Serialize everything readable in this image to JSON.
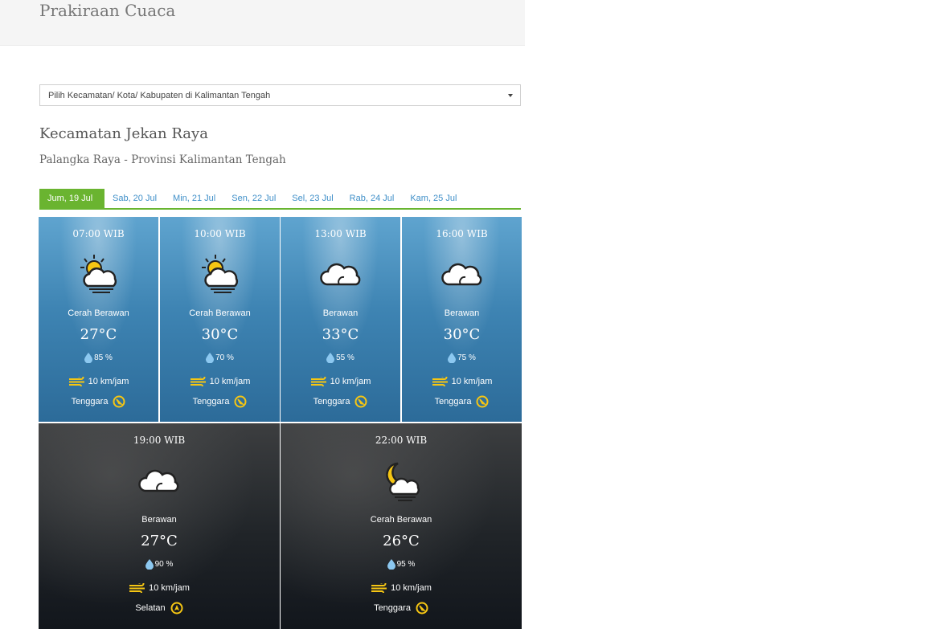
{
  "page": {
    "title": "Prakiraan Cuaca"
  },
  "selector": {
    "value": "Pilih Kecamatan/ Kota/ Kabupaten di Kalimantan Tengah"
  },
  "location": {
    "title": "Kecamatan Jekan Raya",
    "subtitle": "Palangka Raya - Provinsi Kalimantan Tengah"
  },
  "tabs": [
    {
      "label": "Jum, 19 Jul",
      "active": true
    },
    {
      "label": "Sab, 20 Jul",
      "active": false
    },
    {
      "label": "Min, 21 Jul",
      "active": false
    },
    {
      "label": "Sen, 22 Jul",
      "active": false
    },
    {
      "label": "Sel, 23 Jul",
      "active": false
    },
    {
      "label": "Rab, 24 Jul",
      "active": false
    },
    {
      "label": "Kam, 25 Jul",
      "active": false
    }
  ],
  "forecast": [
    {
      "time": "07:00 WIB",
      "icon": "partly-cloudy-sun-icon",
      "condition": "Cerah Berawan",
      "temp": "27°C",
      "humidity": "85 %",
      "wind": "10 km/jam",
      "direction": "Tenggara",
      "period": "day"
    },
    {
      "time": "10:00 WIB",
      "icon": "partly-cloudy-sun-icon",
      "condition": "Cerah Berawan",
      "temp": "30°C",
      "humidity": "70 %",
      "wind": "10 km/jam",
      "direction": "Tenggara",
      "period": "day"
    },
    {
      "time": "13:00 WIB",
      "icon": "cloud-icon",
      "condition": "Berawan",
      "temp": "33°C",
      "humidity": "55 %",
      "wind": "10 km/jam",
      "direction": "Tenggara",
      "period": "day"
    },
    {
      "time": "16:00 WIB",
      "icon": "cloud-icon",
      "condition": "Berawan",
      "temp": "30°C",
      "humidity": "75 %",
      "wind": "10 km/jam",
      "direction": "Tenggara",
      "period": "day"
    },
    {
      "time": "19:00 WIB",
      "icon": "cloud-icon",
      "condition": "Berawan",
      "temp": "27°C",
      "humidity": "90 %",
      "wind": "10 km/jam",
      "direction": "Selatan",
      "period": "night"
    },
    {
      "time": "22:00 WIB",
      "icon": "partly-cloudy-moon-icon",
      "condition": "Cerah Berawan",
      "temp": "26°C",
      "humidity": "95 %",
      "wind": "10 km/jam",
      "direction": "Tenggara",
      "period": "night"
    }
  ],
  "colors": {
    "tab_active_bg": "#6ab430",
    "tab_link": "#3f8fc8",
    "icon_yellow": "#f6c613",
    "drop_blue": "#8cc8f0"
  }
}
